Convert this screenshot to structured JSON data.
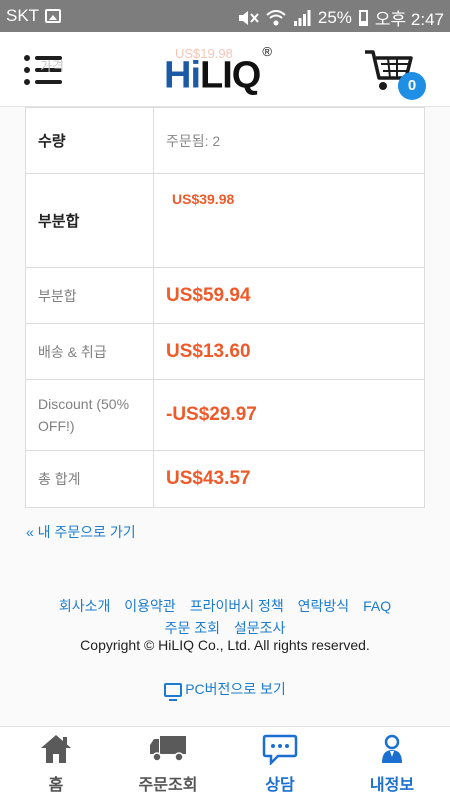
{
  "status_bar": {
    "carrier": "SKT",
    "battery_pct": "25%",
    "time": "오후 2:47"
  },
  "header": {
    "logo_hi": "Hi",
    "logo_liq": "LIQ",
    "logo_mark": "®",
    "cart_count": "0",
    "ghost_label": "가격",
    "ghost_price": "US$19.98"
  },
  "order_table": {
    "rows": [
      {
        "label": "수량",
        "value": "주문됨: 2"
      },
      {
        "label": "부분합",
        "value": "US$39.98"
      },
      {
        "label": "부분합",
        "value": "US$59.94"
      },
      {
        "label": "배송 & 취급",
        "value": "US$13.60"
      },
      {
        "label": "Discount (50% OFF!)",
        "value": "-US$29.97"
      },
      {
        "label": "총 합계",
        "value": "US$43.57"
      }
    ]
  },
  "back_link": "« 내 주문으로 가기",
  "footer": {
    "links_row1": [
      "회사소개",
      "이용약관",
      "프라이버시 정책",
      "연락방식",
      "FAQ"
    ],
    "links_row2": [
      "주문 조회",
      "설문조사"
    ],
    "copyright": "Copyright © HiLIQ Co., Ltd. All rights reserved.",
    "pc_version": "PC버전으로 보기"
  },
  "bottom_nav": [
    {
      "label": "홈",
      "icon": "home-icon"
    },
    {
      "label": "주문조회",
      "icon": "truck-icon"
    },
    {
      "label": "상담",
      "icon": "chat-icon"
    },
    {
      "label": "내정보",
      "icon": "person-icon"
    }
  ],
  "colors": {
    "price": "#ee5a2a",
    "link": "#1a7ccf",
    "brand_blue": "#1c5aa8",
    "status_bar": "#7d7d7d"
  }
}
